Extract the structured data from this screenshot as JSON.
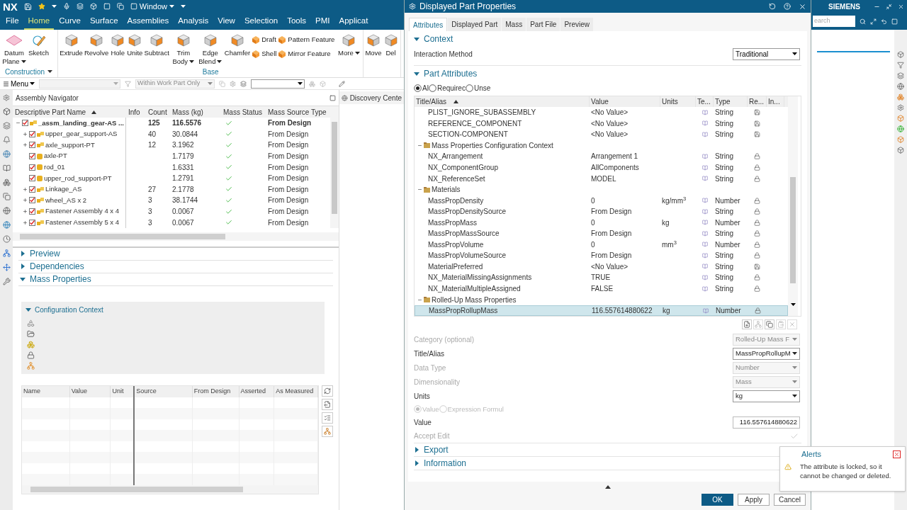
{
  "title_bar": {
    "logo": "NX",
    "window_menu": "Window",
    "brand": "SIEMENS",
    "search_placeholder": "earch"
  },
  "menu_tabs": [
    {
      "label": "File",
      "selected": false
    },
    {
      "label": "Home",
      "selected": true
    },
    {
      "label": "Curve",
      "selected": false
    },
    {
      "label": "Surface",
      "selected": false
    },
    {
      "label": "Assemblies",
      "selected": false
    },
    {
      "label": "Analysis",
      "selected": false
    },
    {
      "label": "View",
      "selected": false
    },
    {
      "label": "Selection",
      "selected": false
    },
    {
      "label": "Tools",
      "selected": false
    },
    {
      "label": "PMI",
      "selected": false
    },
    {
      "label": "Applicat",
      "selected": false
    }
  ],
  "ribbon": {
    "groups": [
      {
        "name": "Construction",
        "commands": [
          {
            "kind": "large",
            "label": "Datum Plane",
            "dropdown": true
          },
          {
            "kind": "large",
            "label": "Sketch",
            "dropdown": false
          }
        ]
      },
      {
        "name": "Base",
        "commands": [
          {
            "kind": "large",
            "label": "Extrude",
            "dropdown": false
          },
          {
            "kind": "large",
            "label": "Revolve",
            "dropdown": false
          },
          {
            "kind": "large",
            "label": "Hole",
            "dropdown": false
          },
          {
            "kind": "large",
            "label": "Unite",
            "dropdown": false
          },
          {
            "kind": "large",
            "label": "Subtract",
            "dropdown": false
          },
          {
            "kind": "large",
            "label": "Trim Body",
            "dropdown": true
          },
          {
            "kind": "large",
            "label": "Edge Blend",
            "dropdown": true
          },
          {
            "kind": "large",
            "label": "Chamfer",
            "dropdown": false
          },
          {
            "kind": "stack",
            "items": [
              "Draft",
              "Shell"
            ]
          },
          {
            "kind": "stack",
            "items": [
              "Pattern Feature",
              "Mirror Feature"
            ]
          },
          {
            "kind": "large",
            "label": "More",
            "dropdown": true
          }
        ]
      },
      {
        "commands": [
          {
            "kind": "large",
            "label": "Move",
            "dropdown": false
          },
          {
            "kind": "large",
            "label": "Del",
            "dropdown": false
          }
        ]
      }
    ]
  },
  "toolbar": {
    "menu_button": "Menu",
    "scope_filter": {
      "value": "Within Work Part Only",
      "disabled": true
    }
  },
  "navigator": {
    "title": "Assembly Navigator",
    "columns": [
      {
        "label": "Descriptive Part Name",
        "sorted": true
      },
      {
        "label": "Info"
      },
      {
        "label": "Count"
      },
      {
        "label": "Mass (kg)"
      },
      {
        "label": "Mass Status"
      },
      {
        "label": "Mass Source Type"
      }
    ],
    "rows": [
      {
        "name": "_assm_landing_gear-AS ...",
        "kind": "assembly",
        "checked": true,
        "expanded": true,
        "count": "125",
        "mass": "116.5576",
        "mass_ok": true,
        "source": "From Design",
        "children": [
          {
            "name": "upper_gear_support-AS",
            "kind": "assembly",
            "checked": true,
            "expanded": false,
            "count": "40",
            "mass": "30.0844",
            "mass_ok": true,
            "source": "From Design"
          },
          {
            "name": "axle_support-PT",
            "kind": "assembly",
            "checked": true,
            "expanded": false,
            "count": "12",
            "mass": "3.1962",
            "mass_ok": true,
            "source": "From Design"
          },
          {
            "name": "axle-PT",
            "kind": "part",
            "checked": true,
            "mass": "1.7179",
            "mass_ok": true,
            "source": "From Design"
          },
          {
            "name": "rod_01",
            "kind": "part",
            "checked": true,
            "mass": "1.6331",
            "mass_ok": true,
            "source": "From Design"
          },
          {
            "name": "upper_rod_support-PT",
            "kind": "part",
            "checked": true,
            "mass": "1.2791",
            "mass_ok": true,
            "source": "From Design"
          },
          {
            "name": "Linkage_AS",
            "kind": "assembly",
            "checked": true,
            "expanded": false,
            "count": "27",
            "mass": "2.1778",
            "mass_ok": true,
            "source": "From Design"
          },
          {
            "name": "wheel_AS x 2",
            "kind": "assembly",
            "checked": true,
            "expanded": false,
            "count": "3",
            "mass": "38.1744",
            "mass_ok": true,
            "source": "From Design"
          },
          {
            "name": "Fastener Assembly 4 x 4",
            "kind": "assembly",
            "checked": true,
            "expanded": false,
            "count": "3",
            "mass": "0.0067",
            "mass_ok": true,
            "source": "From Design"
          },
          {
            "name": "Fastener Assembly 5 x 4",
            "kind": "assembly",
            "checked": true,
            "expanded": false,
            "count": "3",
            "mass": "0.0067",
            "mass_ok": true,
            "source": "From Design"
          }
        ]
      }
    ],
    "sections": [
      {
        "label": "Preview",
        "expanded": false
      },
      {
        "label": "Dependencies",
        "expanded": false
      },
      {
        "label": "Mass Properties",
        "expanded": true
      }
    ],
    "configuration_context": {
      "label": "Configuration Context",
      "expanded": true
    },
    "mass_table": {
      "columns": [
        "Name",
        "Value",
        "Unit",
        "Source",
        "From Design",
        "Asserted",
        "As Measured"
      ]
    }
  },
  "discovery_tab": "Discovery Cente",
  "dialog": {
    "title": "Displayed Part Properties",
    "tabs": [
      {
        "label": "Attributes",
        "selected": true
      },
      {
        "label": "Displayed Part",
        "selected": false
      },
      {
        "label": "Mass",
        "selected": false
      },
      {
        "label": "Part File",
        "selected": false
      },
      {
        "label": "Preview",
        "selected": false
      }
    ],
    "context": {
      "label": "Context",
      "expanded": true,
      "field_label": "Interaction Method",
      "value": "Traditional"
    },
    "part_attributes": {
      "label": "Part Attributes",
      "expanded": true,
      "filters": [
        {
          "label": "Al",
          "selected": true
        },
        {
          "label": "Requirec",
          "selected": false
        },
        {
          "label": "Unse",
          "selected": false
        }
      ],
      "columns": [
        {
          "label": "Title/Alias",
          "sorted": true
        },
        {
          "label": "Value"
        },
        {
          "label": "Units"
        },
        {
          "label": "Te..."
        },
        {
          "label": "Type"
        },
        {
          "label": "Re..."
        },
        {
          "label": "In..."
        }
      ],
      "rows": [
        {
          "kind": "attribute",
          "title": "PLIST_IGNORE_SUBASSEMBLY",
          "value": "<No Value>",
          "type": "String",
          "locked": false,
          "selected": false
        },
        {
          "kind": "attribute",
          "title": "REFERENCE_COMPONENT",
          "value": "<No Value>",
          "type": "String",
          "locked": false,
          "selected": false
        },
        {
          "kind": "attribute",
          "title": "SECTION-COMPONENT",
          "value": "<No Value>",
          "type": "String",
          "locked": false,
          "selected": false
        },
        {
          "kind": "group",
          "title": "Mass Properties Configuration Context",
          "expanded": true,
          "children": [
            {
              "kind": "attribute",
              "title": "NX_Arrangement",
              "value": "Arrangement 1",
              "type": "String",
              "locked": true,
              "selected": false
            },
            {
              "kind": "attribute",
              "title": "NX_ComponentGroup",
              "value": "AllComponents",
              "type": "String",
              "locked": true,
              "selected": false
            },
            {
              "kind": "attribute",
              "title": "NX_ReferenceSet",
              "value": "MODEL",
              "type": "String",
              "locked": true,
              "selected": false
            }
          ]
        },
        {
          "kind": "group",
          "title": "Materials",
          "expanded": true,
          "children": [
            {
              "kind": "attribute",
              "title": "MassPropDensity",
              "value": "0",
              "units": "kg/mm$^{3}$",
              "type": "Number",
              "locked": true,
              "selected": false
            },
            {
              "kind": "attribute",
              "title": "MassPropDensitySource",
              "value": "From Design",
              "type": "String",
              "locked": true,
              "selected": false
            },
            {
              "kind": "attribute",
              "title": "MassPropMass",
              "value": "0",
              "units": "kg",
              "type": "Number",
              "locked": true,
              "selected": false
            },
            {
              "kind": "attribute",
              "title": "MassPropMassSource",
              "value": "From Design",
              "type": "String",
              "locked": true,
              "selected": false
            },
            {
              "kind": "attribute",
              "title": "MassPropVolume",
              "value": "0",
              "units": "mm$^{3}$",
              "type": "Number",
              "locked": true,
              "selected": false
            },
            {
              "kind": "attribute",
              "title": "MassPropVolumeSource",
              "value": "From Design",
              "type": "String",
              "locked": true,
              "selected": false
            },
            {
              "kind": "attribute",
              "title": "MaterialPreferred",
              "value": "<No Value>",
              "type": "String",
              "locked": false,
              "selected": false
            },
            {
              "kind": "attribute",
              "title": "NX_MaterialMissingAssignments",
              "value": "TRUE",
              "type": "String",
              "locked": true,
              "selected": false
            },
            {
              "kind": "attribute",
              "title": "NX_MaterialMultipleAssigned",
              "value": "FALSE",
              "type": "String",
              "locked": true,
              "selected": false
            }
          ]
        },
        {
          "kind": "group",
          "title": "Rolled-Up Mass Properties",
          "expanded": true,
          "children": [
            {
              "kind": "attribute",
              "title": "MassPropRollupMass",
              "value": "116.557614880622",
              "units": "kg",
              "type": "Number",
              "locked": true,
              "selected": true
            }
          ]
        }
      ]
    },
    "editor": [
      {
        "kind": "dropdown",
        "label": "Category (optional)",
        "value": "Rolled-Up Mass F",
        "disabled": true
      },
      {
        "kind": "dropdown",
        "label": "Title/Alias",
        "value": "MassPropRollupM",
        "disabled": false
      },
      {
        "kind": "dropdown",
        "label": "Data Type",
        "value": "Number",
        "disabled": true
      },
      {
        "kind": "dropdown",
        "label": "Dimensionality",
        "value": "Mass",
        "disabled": true
      },
      {
        "kind": "dropdown",
        "label": "Units",
        "value": "kg",
        "disabled": false
      },
      {
        "kind": "radios",
        "disabled": true,
        "options": [
          {
            "label": "Value",
            "selected": true
          },
          {
            "label": "Expression Formul",
            "selected": false
          }
        ]
      },
      {
        "kind": "text",
        "label": "Value",
        "value": "116.557614880622",
        "disabled": false
      },
      {
        "kind": "accept",
        "label": "Accept Edit",
        "disabled": true
      }
    ],
    "sections": [
      {
        "label": "Export",
        "expanded": false
      },
      {
        "label": "Information",
        "expanded": false
      }
    ],
    "buttons": [
      {
        "label": "OK",
        "kind": "primary"
      },
      {
        "label": "Apply",
        "kind": "normal"
      },
      {
        "label": "Cancel",
        "kind": "normal"
      }
    ]
  },
  "alert": {
    "title": "Alerts",
    "message": "The attribute is locked, so it cannot be changed or deleted."
  }
}
